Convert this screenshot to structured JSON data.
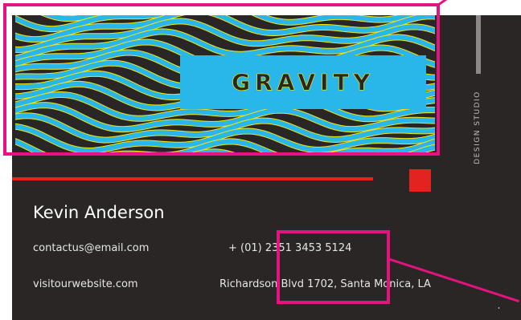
{
  "brand": {
    "title": "GRAVITY",
    "tagline": "DESIGN STUDIO"
  },
  "contact": {
    "name": "Kevin Anderson",
    "email": "contactus@email.com",
    "phone": "+ (01) 2351 3453 5124",
    "website": "visitourwebsite.com",
    "address": "Richardson Blvd 1702, Santa Monica, LA"
  },
  "colors": {
    "card_background": "#2a2626",
    "wave_cyan": "#29b6e8",
    "wave_outline_yellow": "#f4e60f",
    "accent_red": "#e3231f",
    "highlight_magenta": "#e5137f",
    "divider_gray": "#8a8888"
  },
  "icons": {
    "wave_pattern": "wavy-stripes-pattern"
  }
}
